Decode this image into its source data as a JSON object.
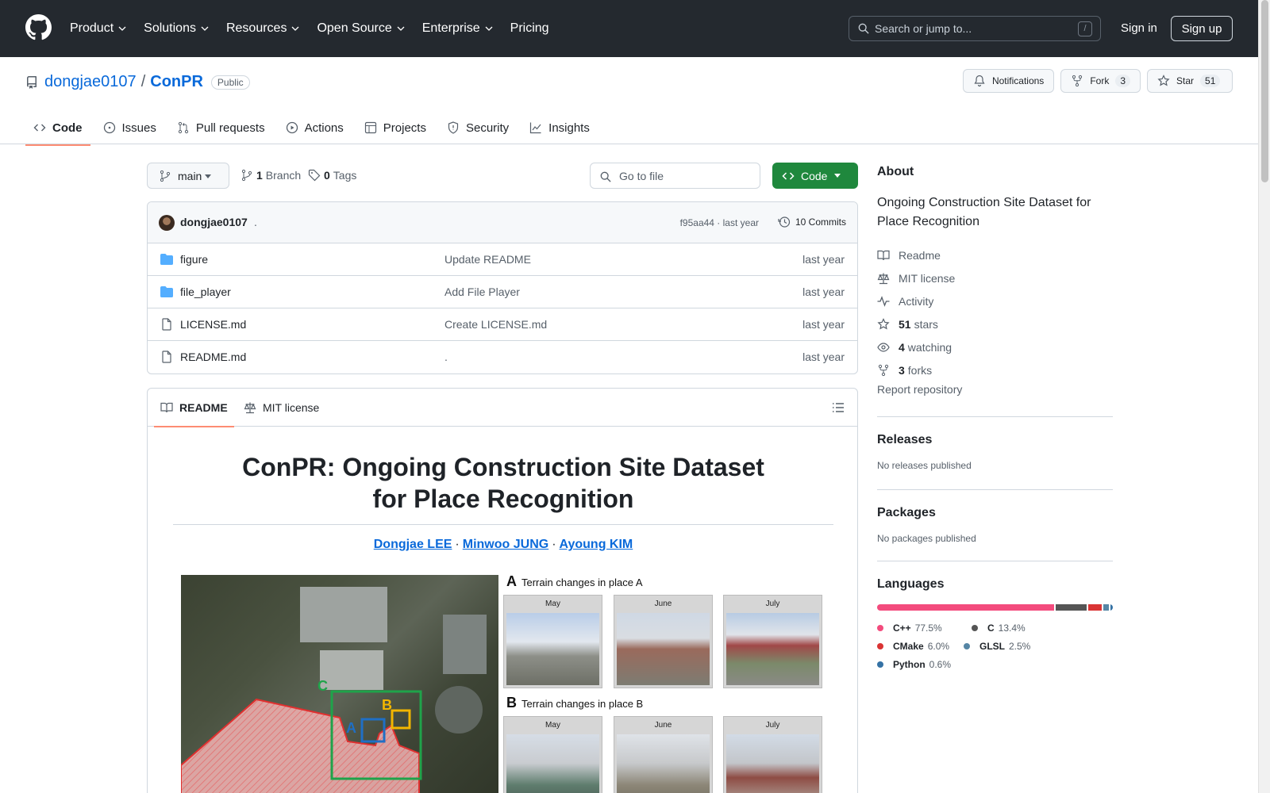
{
  "header": {
    "nav": [
      {
        "label": "Product",
        "dropdown": true
      },
      {
        "label": "Solutions",
        "dropdown": true
      },
      {
        "label": "Resources",
        "dropdown": true
      },
      {
        "label": "Open Source",
        "dropdown": true
      },
      {
        "label": "Enterprise",
        "dropdown": true
      },
      {
        "label": "Pricing",
        "dropdown": false
      }
    ],
    "search_placeholder": "Search or jump to...",
    "search_shortcut": "/",
    "signin": "Sign in",
    "signup": "Sign up"
  },
  "repo": {
    "owner": "dongjae0107",
    "separator": "/",
    "name": "ConPR",
    "visibility": "Public",
    "notifications_label": "Notifications",
    "fork_label": "Fork",
    "fork_count": "3",
    "star_label": "Star",
    "star_count": "51",
    "tabs": [
      {
        "label": "Code",
        "icon": "code-icon",
        "active": true
      },
      {
        "label": "Issues",
        "icon": "issue-icon",
        "active": false
      },
      {
        "label": "Pull requests",
        "icon": "pull-request-icon",
        "active": false
      },
      {
        "label": "Actions",
        "icon": "play-icon",
        "active": false
      },
      {
        "label": "Projects",
        "icon": "table-icon",
        "active": false
      },
      {
        "label": "Security",
        "icon": "shield-icon",
        "active": false
      },
      {
        "label": "Insights",
        "icon": "graph-icon",
        "active": false
      }
    ]
  },
  "toolbar": {
    "branch": "main",
    "branch_count": "1",
    "branch_label": "Branch",
    "tag_count": "0",
    "tag_label": "Tags",
    "goto_placeholder": "Go to file",
    "code_button": "Code"
  },
  "commit": {
    "author": "dongjae0107",
    "message": ".",
    "sha_time": "f95aa44 · last year",
    "commits": "10 Commits"
  },
  "files": [
    {
      "type": "folder",
      "name": "figure",
      "message": "Update README",
      "time": "last year"
    },
    {
      "type": "folder",
      "name": "file_player",
      "message": "Add File Player",
      "time": "last year"
    },
    {
      "type": "file",
      "name": "LICENSE.md",
      "message": "Create LICENSE.md",
      "time": "last year"
    },
    {
      "type": "file",
      "name": "README.md",
      "message": ".",
      "time": "last year"
    }
  ],
  "readme": {
    "tab_readme": "README",
    "tab_license": "MIT license",
    "title_line1": "ConPR: Ongoing Construction Site Dataset",
    "title_line2": "for Place Recognition",
    "authors": [
      "Dongjae LEE",
      "Minwoo JUNG",
      "Ayoung KIM"
    ],
    "author_sep": "·",
    "figure": {
      "panel_a_letter": "A",
      "panel_a_text": "Terrain changes in place A",
      "panel_b_letter": "B",
      "panel_b_text": "Terrain changes in place B",
      "months": [
        "May",
        "June",
        "July"
      ],
      "map_labels": [
        "A",
        "B",
        "C"
      ]
    }
  },
  "about": {
    "heading": "About",
    "description": "Ongoing Construction Site Dataset for Place Recognition",
    "links": [
      {
        "icon": "book-icon",
        "strong": "",
        "label": "Readme"
      },
      {
        "icon": "law-icon",
        "strong": "",
        "label": "MIT license"
      },
      {
        "icon": "pulse-icon",
        "strong": "",
        "label": "Activity"
      },
      {
        "icon": "star-icon",
        "strong": "51",
        "label": "stars"
      },
      {
        "icon": "eye-icon",
        "strong": "4",
        "label": "watching"
      },
      {
        "icon": "fork-icon",
        "strong": "3",
        "label": "forks"
      }
    ],
    "report": "Report repository"
  },
  "releases": {
    "heading": "Releases",
    "empty": "No releases published"
  },
  "packages": {
    "heading": "Packages",
    "empty": "No packages published"
  },
  "languages": {
    "heading": "Languages",
    "items": [
      {
        "name": "C++",
        "percent": "77.5%",
        "value": 77.5,
        "color": "#f34b7d"
      },
      {
        "name": "C",
        "percent": "13.4%",
        "value": 13.4,
        "color": "#555555"
      },
      {
        "name": "CMake",
        "percent": "6.0%",
        "value": 6.0,
        "color": "#da3434"
      },
      {
        "name": "GLSL",
        "percent": "2.5%",
        "value": 2.5,
        "color": "#5686a5"
      },
      {
        "name": "Python",
        "percent": "0.6%",
        "value": 0.6,
        "color": "#3572A5"
      }
    ]
  }
}
